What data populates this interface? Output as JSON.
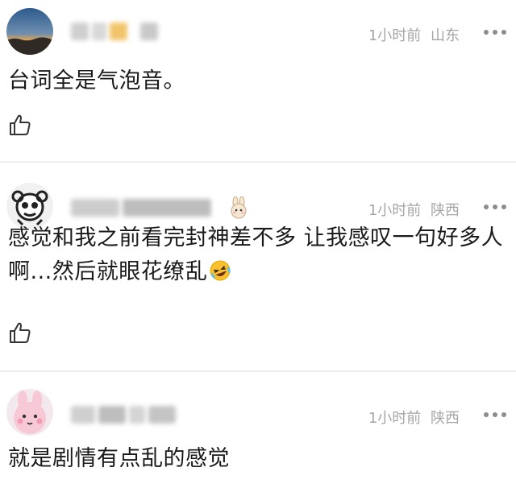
{
  "comments": [
    {
      "time": "1小时前",
      "location": "山东",
      "text": "台词全是气泡音。",
      "avatar_icon": "sunset-avatar-icon"
    },
    {
      "time": "1小时前",
      "location": "陕西",
      "text": "感觉和我之前看完封神差不多 让我感叹一句好多人啊...然后就眼花缭乱",
      "avatar_icon": "sheep-avatar-icon",
      "badge_icon": "rabbit-badge-icon",
      "emoji_icon": "rofl-emoji-icon"
    },
    {
      "time": "1小时前",
      "location": "陕西",
      "text": "就是剧情有点乱的感觉",
      "avatar_icon": "pink-bunny-avatar-icon"
    }
  ],
  "icons": {
    "like": "thumbs-up-icon",
    "more": "more-dots-icon"
  },
  "colors": {
    "meta": "#a6a6a6",
    "divider": "#eeeeee",
    "text": "#1a1a1a"
  }
}
